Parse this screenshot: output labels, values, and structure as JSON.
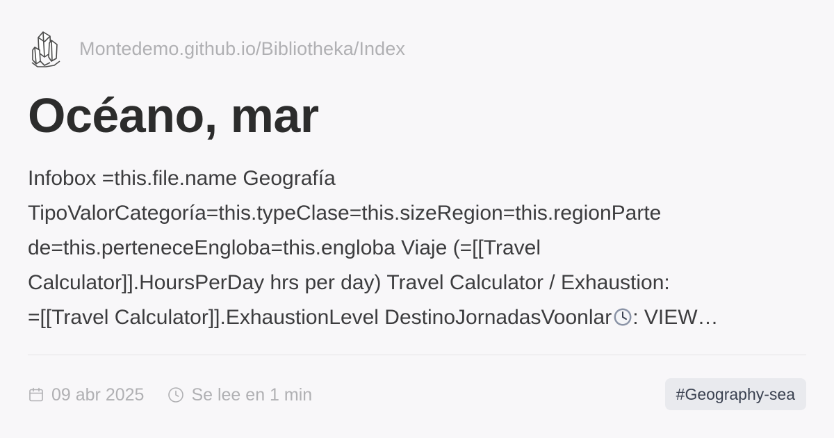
{
  "site": {
    "url": "Montedemo.github.io/Bibliotheka/Index",
    "logo_icon": "crystal-cluster-icon"
  },
  "page": {
    "title": "Océano, mar"
  },
  "excerpt": {
    "lines": [
      "Infobox =this.file.name Geografía",
      "TipoValorCategoría=this.typeClase=this.sizeRegion=this.regionParte",
      "de=this.perteneceEngloba=this.engloba Viaje (=[[Travel",
      "Calculator]].HoursPerDay hrs per day) Travel Calculator / Exhaustion:"
    ],
    "last_line_before_icon": "=[[Travel Calculator]].ExhaustionLevel DestinoJornadasVoonlar",
    "last_line_after_icon": ": VIEW…",
    "inline_icon": "clock-emoji-icon"
  },
  "meta": {
    "date": "09 abr 2025",
    "date_icon": "calendar-icon",
    "read_time": "Se lee en 1 min",
    "read_time_icon": "clock-icon"
  },
  "tag": {
    "label": "#Geography-sea"
  },
  "colors": {
    "background": "#f8f7f9",
    "title": "#2c2c2c",
    "muted": "#b0b0b3",
    "tag_bg": "#e9eaee"
  }
}
